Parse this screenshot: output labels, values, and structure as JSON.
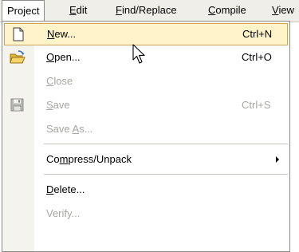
{
  "menubar": {
    "items": [
      {
        "pre": "Pro",
        "mn": "j",
        "post": "ect",
        "active": true
      },
      {
        "pre": "",
        "mn": "E",
        "post": "dit"
      },
      {
        "pre": "",
        "mn": "F",
        "post": "ind/Replace"
      },
      {
        "pre": "",
        "mn": "C",
        "post": "ompile"
      },
      {
        "pre": "",
        "mn": "V",
        "post": "iew"
      }
    ]
  },
  "menu": {
    "items": [
      {
        "pre": "",
        "mn": "N",
        "post": "ew...",
        "shortcut": "Ctrl+N",
        "icon": "new-document-icon",
        "enabled": true,
        "highlighted": true
      },
      {
        "pre": "",
        "mn": "O",
        "post": "pen...",
        "shortcut": "Ctrl+O",
        "icon": "open-folder-icon",
        "enabled": true
      },
      {
        "pre": "",
        "mn": "C",
        "post": "lose",
        "shortcut": "",
        "enabled": false
      },
      {
        "pre": "",
        "mn": "S",
        "post": "ave",
        "shortcut": "Ctrl+S",
        "icon": "save-disk-icon",
        "enabled": false
      },
      {
        "pre": "Save ",
        "mn": "A",
        "post": "s...",
        "shortcut": "",
        "enabled": false
      },
      {
        "pre": "Co",
        "mn": "m",
        "post": "press/Unpack",
        "shortcut": "",
        "enabled": true,
        "submenu": true
      },
      {
        "pre": "",
        "mn": "D",
        "post": "elete...",
        "shortcut": "",
        "enabled": true
      },
      {
        "pre": "Verify...",
        "mn": "",
        "post": "",
        "shortcut": "",
        "enabled": false
      }
    ]
  },
  "colors": {
    "highlight_fill": "#fff3c9",
    "highlight_border": "#c9a35a",
    "disabled_text": "#a7a6a0",
    "menubar_bg": "#efeee8"
  }
}
